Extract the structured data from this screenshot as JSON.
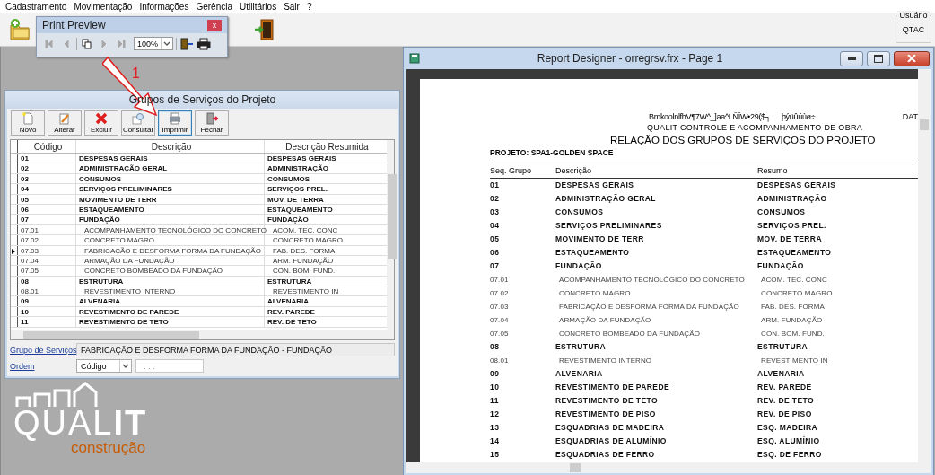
{
  "menu": [
    "Cadastramento",
    "Movimentação",
    "Informações",
    "Gerência",
    "Utilitários",
    "Sair",
    "?"
  ],
  "user_box": {
    "label": "Usuário",
    "value": "QTAC"
  },
  "print_preview": {
    "title": "Print Preview",
    "close": "x",
    "zoom": "100%",
    "tools": [
      {
        "kind": "first",
        "disabled": true
      },
      {
        "kind": "prev",
        "disabled": true
      },
      {
        "kind": "pages",
        "disabled": false
      },
      {
        "kind": "next",
        "disabled": true
      },
      {
        "kind": "last",
        "disabled": true
      },
      {
        "kind": "zoom",
        "disabled": false
      },
      {
        "kind": "exit",
        "disabled": false
      },
      {
        "kind": "print",
        "disabled": false
      }
    ]
  },
  "annotation": {
    "label": "1"
  },
  "grupos_window": {
    "title": "Grupos de Serviços do Projeto",
    "toolbar": [
      {
        "label": "Novo",
        "kind": "new",
        "focused": false
      },
      {
        "label": "Alterar",
        "kind": "edit",
        "focused": false
      },
      {
        "label": "Excluir",
        "kind": "delete",
        "focused": false
      },
      {
        "label": "Consultar",
        "kind": "search",
        "focused": false
      },
      {
        "label": "Imprimir",
        "kind": "print",
        "focused": true
      },
      {
        "label": "Fechar",
        "kind": "exit",
        "focused": false
      }
    ],
    "table": {
      "columns": [
        "Código",
        "Descrição",
        "Descrição Resumida"
      ],
      "rows": [
        {
          "code": "01",
          "description": "DESPESAS GERAIS",
          "short": "DESPESAS GERAIS",
          "kind": "group",
          "selected": false
        },
        {
          "code": "02",
          "description": "ADMINISTRAÇÃO GERAL",
          "short": "ADMINISTRAÇÃO",
          "kind": "group",
          "selected": false
        },
        {
          "code": "03",
          "description": "CONSUMOS",
          "short": "CONSUMOS",
          "kind": "group",
          "selected": false
        },
        {
          "code": "04",
          "description": "SERVIÇOS PRELIMINARES",
          "short": "SERVIÇOS PREL.",
          "kind": "group",
          "selected": false
        },
        {
          "code": "05",
          "description": "MOVIMENTO DE TERR",
          "short": "MOV. DE TERRA",
          "kind": "group",
          "selected": false
        },
        {
          "code": "06",
          "description": "ESTAQUEAMENTO",
          "short": "ESTAQUEAMENTO",
          "kind": "group",
          "selected": false
        },
        {
          "code": "07",
          "description": "FUNDAÇÃO",
          "short": "FUNDAÇÃO",
          "kind": "group",
          "selected": false
        },
        {
          "code": "07.01",
          "description": "ACOMPANHAMENTO TECNOLÓGICO DO CONCRETO",
          "short": "ACOM. TEC. CONC",
          "kind": "item",
          "selected": false
        },
        {
          "code": "07.02",
          "description": "CONCRETO MAGRO",
          "short": "CONCRETO MAGRO",
          "kind": "item",
          "selected": false
        },
        {
          "code": "07.03",
          "description": "FABRICAÇÃO E DESFORMA FORMA DA FUNDAÇÃO",
          "short": "FAB. DES. FORMA",
          "kind": "item",
          "selected": true
        },
        {
          "code": "07.04",
          "description": "ARMAÇÃO DA FUNDAÇÃO",
          "short": "ARM. FUNDAÇÃO",
          "kind": "item",
          "selected": false
        },
        {
          "code": "07.05",
          "description": "CONCRETO BOMBEADO DA FUNDAÇÃO",
          "short": "CON. BOM. FUND.",
          "kind": "item",
          "selected": false
        },
        {
          "code": "08",
          "description": "ESTRUTURA",
          "short": "ESTRUTURA",
          "kind": "group",
          "selected": false
        },
        {
          "code": "08.01",
          "description": "REVESTIMENTO INTERNO",
          "short": "REVESTIMENTO IN",
          "kind": "item",
          "selected": false
        },
        {
          "code": "09",
          "description": "ALVENARIA",
          "short": "ALVENARIA",
          "kind": "group",
          "selected": false
        },
        {
          "code": "10",
          "description": "REVESTIMENTO DE PAREDE",
          "short": "REV. PAREDE",
          "kind": "group",
          "selected": false
        },
        {
          "code": "11",
          "description": "REVESTIMENTO DE TETO",
          "short": "REV. DE TETO",
          "kind": "group",
          "selected": false
        }
      ]
    },
    "group_field": {
      "label": "Grupo de Serviços",
      "value": "FABRICAÇÃO E DESFORMA FORMA DA FUNDAÇÃO - FUNDAÇÃO"
    },
    "order_field": {
      "label": "Ordem",
      "value": "Código",
      "mask": ". . ."
    }
  },
  "report_window": {
    "title": "Report Designer - orregrsv.frx - Page 1",
    "page": {
      "header_code": "BmkoolnlfhV¶7W^_]aa^LÑÎW•29($┐",
      "header_code_2": "þýüûúùø÷",
      "date_label": "DAT",
      "company": "QUALIT CONTROLE E ACOMPANHAMENTO DE OBRA",
      "title": "RELAÇÃO DOS GRUPOS DE SERVIÇOS DO PROJETO",
      "project": "PROJETO: SPA1-GOLDEN SPACE",
      "columns": [
        "Seq. Grupo",
        "Descrição",
        "Resumo"
      ],
      "rows": [
        {
          "code": "01",
          "description": "DESPESAS GERAIS",
          "summary": "DESPESAS GERAIS",
          "kind": "group"
        },
        {
          "code": "02",
          "description": "ADMINISTRAÇÃO GERAL",
          "summary": "ADMINISTRAÇÃO",
          "kind": "group"
        },
        {
          "code": "03",
          "description": "CONSUMOS",
          "summary": "CONSUMOS",
          "kind": "group"
        },
        {
          "code": "04",
          "description": "SERVIÇOS PRELIMINARES",
          "summary": "SERVIÇOS PREL.",
          "kind": "group"
        },
        {
          "code": "05",
          "description": "MOVIMENTO DE TERR",
          "summary": "MOV. DE TERRA",
          "kind": "group"
        },
        {
          "code": "06",
          "description": "ESTAQUEAMENTO",
          "summary": "ESTAQUEAMENTO",
          "kind": "group"
        },
        {
          "code": "07",
          "description": "FUNDAÇÃO",
          "summary": "FUNDAÇÃO",
          "kind": "group"
        },
        {
          "code": "07.01",
          "description": "ACOMPANHAMENTO TECNOLÓGICO DO CONCRETO",
          "summary": "ACOM. TEC. CONC",
          "kind": "item"
        },
        {
          "code": "07.02",
          "description": "CONCRETO MAGRO",
          "summary": "CONCRETO MAGRO",
          "kind": "item"
        },
        {
          "code": "07.03",
          "description": "FABRICAÇÃO E DESFORMA FORMA DA FUNDAÇÃO",
          "summary": "FAB. DES. FORMA",
          "kind": "item"
        },
        {
          "code": "07.04",
          "description": "ARMAÇÃO DA FUNDAÇÃO",
          "summary": "ARM. FUNDAÇÃO",
          "kind": "item"
        },
        {
          "code": "07.05",
          "description": "CONCRETO BOMBEADO DA FUNDAÇÃO",
          "summary": "CON. BOM. FUND.",
          "kind": "item"
        },
        {
          "code": "08",
          "description": "ESTRUTURA",
          "summary": "ESTRUTURA",
          "kind": "group"
        },
        {
          "code": "08.01",
          "description": "REVESTIMENTO INTERNO",
          "summary": "REVESTIMENTO IN",
          "kind": "item"
        },
        {
          "code": "09",
          "description": "ALVENARIA",
          "summary": "ALVENARIA",
          "kind": "group"
        },
        {
          "code": "10",
          "description": "REVESTIMENTO DE PAREDE",
          "summary": "REV. PAREDE",
          "kind": "group"
        },
        {
          "code": "11",
          "description": "REVESTIMENTO DE TETO",
          "summary": "REV. DE TETO",
          "kind": "group"
        },
        {
          "code": "12",
          "description": "REVESTIMENTO DE PISO",
          "summary": "REV. DE PISO",
          "kind": "group"
        },
        {
          "code": "13",
          "description": "ESQUADRIAS DE MADEIRA",
          "summary": "ESQ. MADEIRA",
          "kind": "group"
        },
        {
          "code": "14",
          "description": "ESQUADRIAS DE ALUMÍNIO",
          "summary": "ESQ.  ALUMÍNIO",
          "kind": "group"
        },
        {
          "code": "15",
          "description": "ESQUADRIAS DE FERRO",
          "summary": "ESQ. DE FERRO",
          "kind": "group"
        }
      ]
    }
  },
  "logo": {
    "brand": "QUAL**IT**",
    "tagline": "construção"
  }
}
